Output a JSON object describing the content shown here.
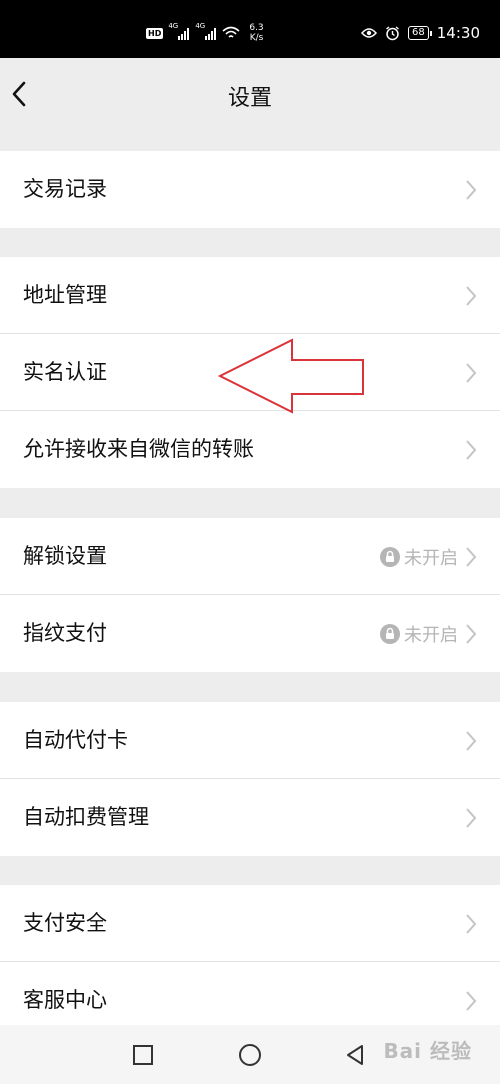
{
  "status_bar": {
    "hd_label": "HD",
    "network_1": "4G",
    "network_2": "4G",
    "speed_value": "6.3",
    "speed_unit": "K/s",
    "battery": "68",
    "time": "14:30"
  },
  "header": {
    "title": "设置"
  },
  "rows": [
    {
      "label": "交易记录"
    },
    {
      "label": "地址管理"
    },
    {
      "label": "实名认证"
    },
    {
      "label": "允许接收来自微信的转账"
    },
    {
      "label": "解锁设置",
      "status": "未开启"
    },
    {
      "label": "指纹支付",
      "status": "未开启"
    },
    {
      "label": "自动代付卡"
    },
    {
      "label": "自动扣费管理"
    },
    {
      "label": "支付安全"
    },
    {
      "label": "客服中心"
    }
  ],
  "annotation": {
    "color": "#d9343a"
  },
  "watermark": "Bai 经验",
  "colors": {
    "background": "#ededed",
    "row_background": "#ffffff",
    "status_text": "#b5b5b5",
    "annotation_red": "#d9343a"
  }
}
